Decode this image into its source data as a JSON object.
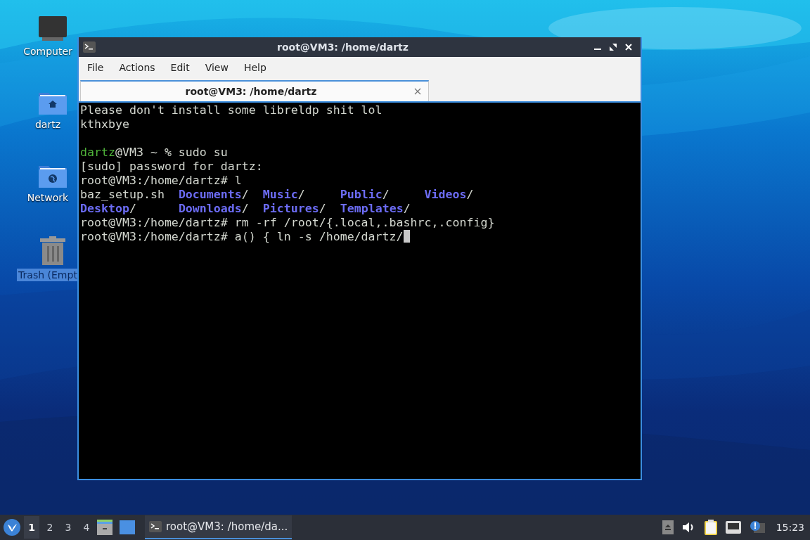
{
  "desktop_icons": [
    {
      "kind": "computer",
      "label": "Computer",
      "selected": false
    },
    {
      "kind": "home",
      "label": "dartz",
      "selected": false
    },
    {
      "kind": "network",
      "label": "Network",
      "selected": false
    },
    {
      "kind": "trash",
      "label": "Trash (Empt",
      "selected": true
    }
  ],
  "window": {
    "title": "root@VM3: /home/dartz",
    "menu": [
      "File",
      "Actions",
      "Edit",
      "View",
      "Help"
    ],
    "tabs": [
      {
        "label": "root@VM3: /home/dartz",
        "selected": true
      }
    ],
    "terminal": [
      {
        "kind": "text",
        "cursor": false,
        "segments": [
          {
            "kind": "plain",
            "text": "Please don't install some libreldp shit lol"
          }
        ]
      },
      {
        "kind": "text",
        "cursor": false,
        "segments": [
          {
            "kind": "plain",
            "text": "kthxbye"
          }
        ]
      },
      {
        "kind": "blank"
      },
      {
        "kind": "text",
        "cursor": false,
        "segments": [
          {
            "kind": "user",
            "text": "dartz"
          },
          {
            "kind": "plain",
            "text": "@VM3 ~ % sudo su"
          }
        ]
      },
      {
        "kind": "text",
        "cursor": false,
        "segments": [
          {
            "kind": "plain",
            "text": "[sudo] password for dartz:"
          }
        ]
      },
      {
        "kind": "text",
        "cursor": false,
        "segments": [
          {
            "kind": "plain",
            "text": "root@VM3:/home/dartz# l"
          }
        ]
      },
      {
        "kind": "text",
        "cursor": false,
        "segments": [
          {
            "kind": "plain",
            "text": "baz_setup.sh  "
          },
          {
            "kind": "dir",
            "text": "Documents"
          },
          {
            "kind": "plain",
            "text": "/  "
          },
          {
            "kind": "dir",
            "text": "Music"
          },
          {
            "kind": "plain",
            "text": "/     "
          },
          {
            "kind": "dir",
            "text": "Public"
          },
          {
            "kind": "plain",
            "text": "/     "
          },
          {
            "kind": "dir",
            "text": "Videos"
          },
          {
            "kind": "plain",
            "text": "/"
          }
        ]
      },
      {
        "kind": "text",
        "cursor": false,
        "segments": [
          {
            "kind": "dir",
            "text": "Desktop"
          },
          {
            "kind": "plain",
            "text": "/      "
          },
          {
            "kind": "dir",
            "text": "Downloads"
          },
          {
            "kind": "plain",
            "text": "/  "
          },
          {
            "kind": "dir",
            "text": "Pictures"
          },
          {
            "kind": "plain",
            "text": "/  "
          },
          {
            "kind": "dir",
            "text": "Templates"
          },
          {
            "kind": "plain",
            "text": "/"
          }
        ]
      },
      {
        "kind": "text",
        "cursor": false,
        "segments": [
          {
            "kind": "plain",
            "text": "root@VM3:/home/dartz# rm -rf /root/{.local,.bashrc,.config}"
          }
        ]
      },
      {
        "kind": "text",
        "cursor": true,
        "segments": [
          {
            "kind": "plain",
            "text": "root@VM3:/home/dartz# a() { ln -s /home/dartz/"
          }
        ]
      }
    ]
  },
  "taskbar": {
    "workspaces": [
      {
        "label": "1",
        "selected": true
      },
      {
        "label": "2",
        "selected": false
      },
      {
        "label": "3",
        "selected": false
      },
      {
        "label": "4",
        "selected": false
      }
    ],
    "tasks": [
      {
        "label": "root@VM3: /home/da...",
        "selected": true
      }
    ],
    "clock": "15:23"
  }
}
